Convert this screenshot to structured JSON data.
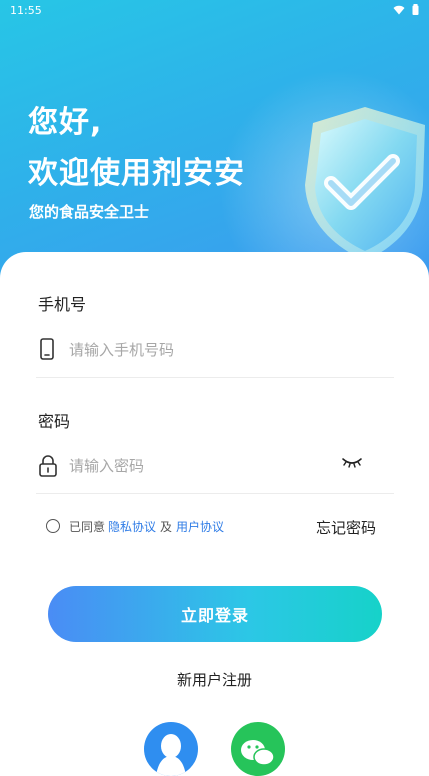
{
  "status": {
    "time": "11:55"
  },
  "hero": {
    "greeting_line1": "您好,",
    "greeting_line2": "欢迎使用剂安安",
    "subtitle": "您的食品安全卫士"
  },
  "form": {
    "phone_label": "手机号",
    "phone_placeholder": "请输入手机号码",
    "password_label": "密码",
    "password_placeholder": "请输入密码"
  },
  "agreement": {
    "prefix": "已同意",
    "privacy_link": "隐私协议",
    "joiner": "及",
    "user_link": "用户协议"
  },
  "forgot_password": "忘记密码",
  "login_button": "立即登录",
  "register_link": "新用户注册",
  "social_logins": [
    {
      "icon": "qq-icon",
      "color": "#2f8ef0"
    },
    {
      "icon": "wechat-icon",
      "color": "#26c45a"
    }
  ],
  "colors": {
    "accent_link": "#2f7ce6",
    "button_gradient_start": "#4a8cf5",
    "button_gradient_end": "#16d2c9"
  }
}
